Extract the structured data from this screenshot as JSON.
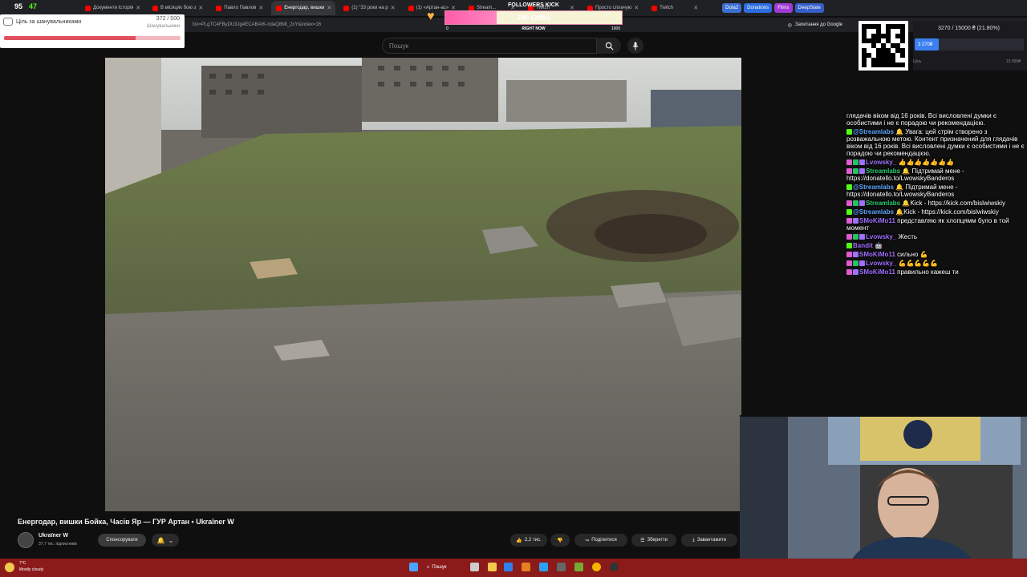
{
  "browser": {
    "tabs": [
      {
        "label": "Документи Історія"
      },
      {
        "label": "В місяцях бою з"
      },
      {
        "label": "Павло Павлов"
      },
      {
        "label": "Енергодар, вишки",
        "active": true
      },
      {
        "label": "(1) \"33 роки на р"
      },
      {
        "label": "(1) «Артан-ас»"
      },
      {
        "label": "Stream..."
      },
      {
        "label": "Twitch"
      },
      {
        "label": "Просто сплачую"
      },
      {
        "label": "Twitch"
      }
    ],
    "bookmark_chips": [
      {
        "label": "Dota2",
        "color": "#3b6fd1"
      },
      {
        "label": "Donations",
        "color": "#2d6de0"
      },
      {
        "label": "Films",
        "color": "#a03ad6"
      },
      {
        "label": "DeepState",
        "color": "#355ec9"
      }
    ],
    "address": "list=PLgTC4FByDU3Jg4ECABAIK-ndaQ8Mt_2xY&index=16",
    "ask_google": "Запитання до Google"
  },
  "kick_counter": {
    "count1": "95",
    "count2": "47"
  },
  "goal_widget": {
    "title": "Ціль за шанувальниками",
    "count": "372 / 500",
    "sub": "Шанувальники",
    "progress": 0.744
  },
  "followers_goal": {
    "label": "FOLLOWERS KICK",
    "value_text": "290 (28%)",
    "progress": 0.29,
    "min": "0",
    "now": "RIGHT NOW",
    "max": "1000"
  },
  "youtube": {
    "search_placeholder": "Пошук",
    "video_title": "Енергодар, вишки Бойка, Часів Яр — ГУР Артан • Ukraïner W",
    "channel_name": "Ukraïner W",
    "subscribers": "37,7 тис. підписників",
    "sponsor_label": "Спонсорувати",
    "likes": "2,2 тис.",
    "share_label": "Поділитися",
    "save_label": "Зберегти",
    "download_label": "Завантажити"
  },
  "donation_goal": {
    "text": "3270 / 15000 ₴ (21.80%)",
    "bar_text": "3 270₴",
    "progress": 0.218,
    "min": "Ціль",
    "max": "15 000₴"
  },
  "chat": [
    {
      "badges": [],
      "user": "",
      "user_color": "",
      "text": "глядачів віком від 16 років. Всі висловлені думки є особистими і не є порадою чи рекомендацією."
    },
    {
      "badges": [
        "kick"
      ],
      "user": "@Streamlabs",
      "user_color": "blue",
      "text": "🔔 Увага: цей стрім створено з розважальною метою. Контент призначений для глядачів віком від 16 років. Всі висловлені думки є особистими і не є порадою чи рекомендацією."
    },
    {
      "badges": [
        "pink",
        "green",
        "star"
      ],
      "user": "Lvowsky_",
      "user_color": "violet",
      "text": "👍👍👍👍👍👍👍"
    },
    {
      "badges": [
        "pink",
        "green",
        "star"
      ],
      "user": "Streamlabs",
      "user_color": "green",
      "text": "🔔 Підтримай мене - https://donatello.to/LwowskyBanderos"
    },
    {
      "badges": [
        "kick"
      ],
      "user": "@Streamlabs",
      "user_color": "blue",
      "text": "🔔 Підтримай мене - https://donatello.to/LwowskyBanderos"
    },
    {
      "badges": [
        "pink",
        "green",
        "star"
      ],
      "user": "Streamlabs",
      "user_color": "green",
      "text": "🔔Kick - https://kick.com/bislwiwskiy"
    },
    {
      "badges": [
        "kick"
      ],
      "user": "@Streamlabs",
      "user_color": "blue",
      "text": "🔔Kick - https://kick.com/bislwiwskiy"
    },
    {
      "badges": [
        "pink",
        "star"
      ],
      "user": "SMoKiMo11",
      "user_color": "violet",
      "text": "представляю як хлопцямм було в той момент"
    },
    {
      "badges": [
        "pink",
        "green",
        "star"
      ],
      "user": "Lvowsky_",
      "user_color": "violet",
      "text": "Жесть"
    },
    {
      "badges": [
        "kick"
      ],
      "user": "Bandit",
      "user_color": "violet",
      "text": "🤖"
    },
    {
      "badges": [
        "pink",
        "star"
      ],
      "user": "SMoKiMo11",
      "user_color": "violet",
      "text": "сильно 💪"
    },
    {
      "badges": [
        "pink",
        "green",
        "star"
      ],
      "user": "Lvowsky_",
      "user_color": "violet",
      "text": "💪💪💪💪💪"
    },
    {
      "badges": [
        "pink",
        "star"
      ],
      "user": "SMoKiMo11",
      "user_color": "violet",
      "text": "правильно кажеш ти"
    }
  ],
  "taskbar": {
    "weather_temp": "7°C",
    "weather_text": "Mostly cloudy",
    "search_label": "Пошук"
  },
  "colors": {
    "youtube_bg": "#0f0f0f",
    "taskbar": "#8b1a1a",
    "kick_green": "#53fc18",
    "goal_fill": "#e0505f",
    "followers_fill": "#ff5ca8",
    "donation_fill": "#3b80f2"
  }
}
